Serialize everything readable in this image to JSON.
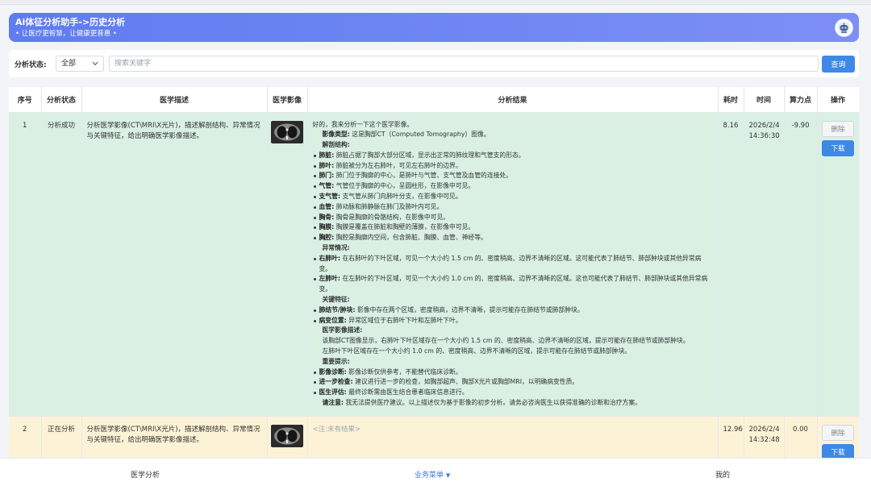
{
  "banner": {
    "title": "Ai体征分析助手->历史分析",
    "subtitle": "• 让医疗更智慧，让健康更普惠 •"
  },
  "filter": {
    "status_label": "分析状态:",
    "status_value": "全部",
    "search_placeholder": "搜索关键字",
    "query_button": "查询"
  },
  "table": {
    "headers": [
      "序号",
      "分析状态",
      "医学描述",
      "医学影像",
      "分析结果",
      "耗时",
      "时间",
      "算力点",
      "操作"
    ],
    "rows": [
      {
        "index": "1",
        "status": "分析成功",
        "description": "分析医学影像(CT\\MRI\\X光片)，描述解剖结构、异常情况与关键特征，给出明确医学影像描述。",
        "duration": "8.16",
        "date": "2026/2/4",
        "clock": "14:36:30",
        "points": "-9.90",
        "delete": "删除",
        "download": "下载",
        "result": {
          "intro": "好的，我来分析一下这个医学影像。",
          "type_label": "影像类型:",
          "type_text": "这是胸部CT（Computed Tomography）图像。",
          "anatomy_title": "解剖结构:",
          "anatomy": [
            {
              "k": "肺脏:",
              "v": "肺脏占据了胸部大部分区域，显示出正常的肺纹理和气管支的形态。"
            },
            {
              "k": "肺叶:",
              "v": "肺脏被分为左右肺叶，可见左右肺叶的边界。"
            },
            {
              "k": "肺门:",
              "v": "肺门位于胸廓的中心，是肺叶与气管、支气管及血管的连接处。"
            },
            {
              "k": "气管:",
              "v": "气管位于胸廓的中心，呈圆柱形，在影像中可见。"
            },
            {
              "k": "支气管:",
              "v": "支气管从肺门向肺叶分支，在影像中可见。"
            },
            {
              "k": "血管:",
              "v": "肺动脉和肺静脉在肺门及肺叶内可见。"
            },
            {
              "k": "胸骨:",
              "v": "胸骨是胸廓的骨骼结构，在影像中可见。"
            },
            {
              "k": "胸膜:",
              "v": "胸膜是覆盖在肺脏和胸壁的薄膜，在影像中可见。"
            },
            {
              "k": "胸腔:",
              "v": "胸腔是胸廓内空间，包含肺脏、胸膜、血管、神经等。"
            }
          ],
          "abnormal_title": "异常情况:",
          "abnormal": [
            {
              "k": "右肺叶:",
              "v": "在右肺叶的下叶区域，可见一个大小约 1.5 cm 的、密度稍高、边界不清晰的区域。这可能代表了肺结节、肺部肿块或其他异常病变。"
            },
            {
              "k": "左肺叶:",
              "v": "在左肺叶的下叶区域，可见一个大小约 1.0 cm 的、密度稍高、边界不清晰的区域。这也可能代表了肺结节、肺部肿块或其他异常病变。"
            }
          ],
          "key_title": "关键特征:",
          "key": [
            {
              "k": "肺结节/肿块:",
              "v": "影像中存在两个区域，密度稍高，边界不清晰，提示可能存在肺结节或肺部肿块。"
            },
            {
              "k": "病变位置:",
              "v": "异常区域位于右肺叶下叶和左肺叶下叶。"
            }
          ],
          "desc_title": "医学影像描述:",
          "desc_line1": "该胸部CT图像显示，右肺叶下叶区域存在一个大小约 1.5 cm 的、密度稍高、边界不清晰的区域，提示可能存在肺结节或肺部肿块。",
          "desc_line2": "左肺叶下叶区域存在一个大小约 1.0 cm 的、密度稍高、边界不清晰的区域，提示可能存在肺结节或肺部肿块。",
          "tips_title": "重要提示:",
          "tips": [
            {
              "k": "影像诊断:",
              "v": "影像诊断仅供参考，不能替代临床诊断。"
            },
            {
              "k": "进一步检查:",
              "v": "建议进行进一步的检查，如胸部超声、胸部X光片或胸部MRI，以明确病变性质。"
            },
            {
              "k": "医生评估:",
              "v": "最终诊断需由医生结合患者临床信息进行。"
            }
          ],
          "note_label": "请注意:",
          "note_text": "我无法提供医疗建议。以上描述仅为基于影像的初步分析。请务必咨询医生以获得准确的诊断和治疗方案。"
        }
      },
      {
        "index": "2",
        "status": "正在分析",
        "description": "分析医学影像(CT\\MRI\\X光片)，描述解剖结构、异常情况与关键特征，给出明确医学影像描述。",
        "result_placeholder": "<注:未有结果>",
        "duration": "12.96",
        "date": "2026/2/4",
        "clock": "14:32:48",
        "points": "0.00",
        "delete": "删除",
        "download": "下载"
      }
    ]
  },
  "bottom_nav": {
    "item1": "医学分析",
    "item2": "业务菜单",
    "item3": "我的"
  },
  "colors": {
    "banner": "#6a83f2",
    "primary_button": "#3e89e6",
    "row_success": "#d9f0e3",
    "row_pending": "#fcf3d6",
    "nav_active": "#3e78d8"
  },
  "icons": {
    "avatar": "robot-avatar-icon",
    "dropdown": "chevron-down-icon",
    "nav_menu": "caret-down-icon"
  }
}
